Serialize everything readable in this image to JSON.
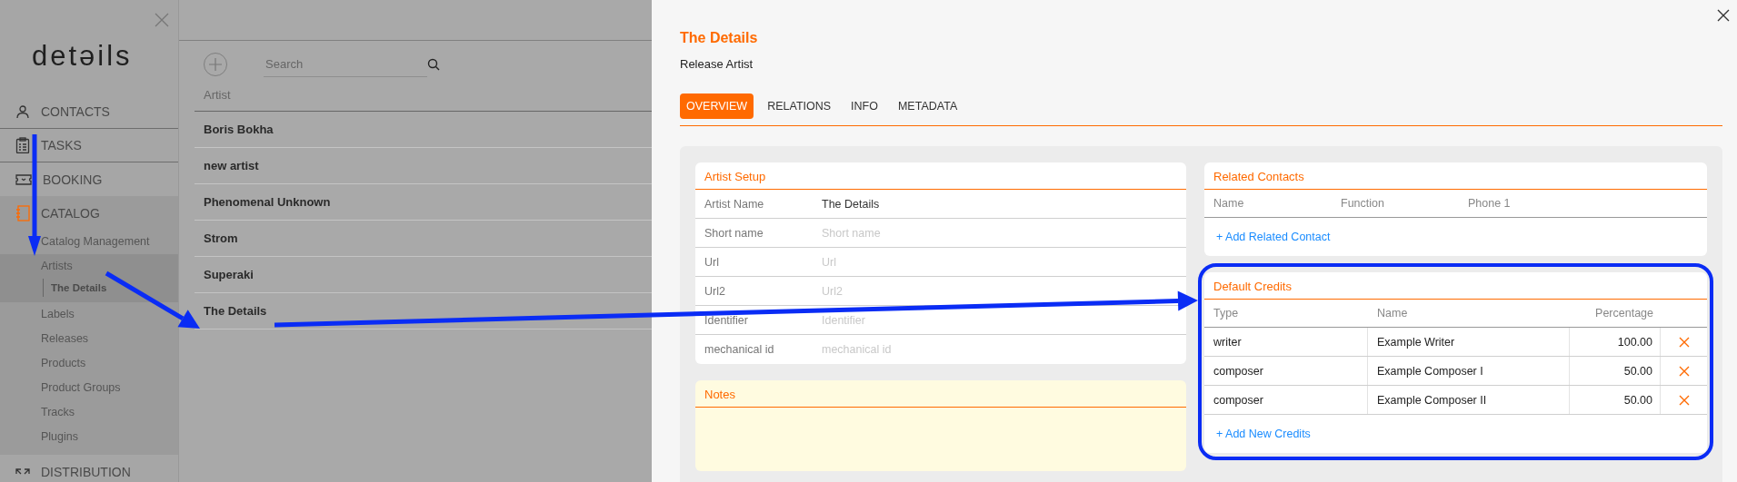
{
  "sidebar": {
    "logo": "detəils",
    "menu": [
      {
        "label": "CONTACTS",
        "selected": false
      },
      {
        "label": "TASKS",
        "selected": false
      },
      {
        "label": "BOOKING",
        "selected": false
      },
      {
        "label": "CATALOG",
        "selected": true,
        "children": [
          {
            "label": "Catalog Management",
            "selected": false
          },
          {
            "label": "Artists",
            "selected": true,
            "children": [
              {
                "label": "The Details"
              }
            ]
          },
          {
            "label": "Labels",
            "selected": false
          },
          {
            "label": "Releases",
            "selected": false
          },
          {
            "label": "Products",
            "selected": false
          },
          {
            "label": "Product Groups",
            "selected": false
          },
          {
            "label": "Tracks",
            "selected": false
          },
          {
            "label": "Plugins",
            "selected": false
          }
        ]
      },
      {
        "label": "DISTRIBUTION",
        "selected": false
      }
    ]
  },
  "list": {
    "search": {
      "placeholder": "Search"
    },
    "column": "Artist",
    "rows": [
      {
        "name": "Boris Bokha"
      },
      {
        "name": "new artist"
      },
      {
        "name": "Phenomenal Unknown"
      },
      {
        "name": "Strom"
      },
      {
        "name": "Superaki"
      },
      {
        "name": "The Details"
      }
    ]
  },
  "detail": {
    "title": "The Details",
    "subtitle": "Release Artist",
    "tabs": [
      {
        "label": "OVERVIEW",
        "selected": true
      },
      {
        "label": "RELATIONS",
        "selected": false
      },
      {
        "label": "INFO",
        "selected": false
      },
      {
        "label": "METADATA",
        "selected": false
      }
    ],
    "artist_setup": {
      "title": "Artist Setup",
      "fields": [
        {
          "label": "Artist Name",
          "value": "The Details"
        },
        {
          "label": "Short name",
          "placeholder": "Short name"
        },
        {
          "label": "Url",
          "placeholder": "Url"
        },
        {
          "label": "Url2",
          "placeholder": "Url2"
        },
        {
          "label": "Identifier",
          "placeholder": "Identifier"
        },
        {
          "label": "mechanical id",
          "placeholder": "mechanical id"
        }
      ]
    },
    "notes": {
      "title": "Notes"
    },
    "related_contacts": {
      "title": "Related Contacts",
      "columns": [
        "Name",
        "Function",
        "Phone 1"
      ],
      "add_link": "+ Add Related Contact"
    },
    "default_credits": {
      "title": "Default Credits",
      "columns": [
        "Type",
        "Name",
        "Percentage"
      ],
      "rows": [
        {
          "type": "writer",
          "name": "Example Writer",
          "percentage": "100.00"
        },
        {
          "type": "composer",
          "name": "Example Composer I",
          "percentage": "50.00"
        },
        {
          "type": "composer",
          "name": "Example Composer II",
          "percentage": "50.00"
        }
      ],
      "add_link": "+ Add New Credits"
    }
  }
}
